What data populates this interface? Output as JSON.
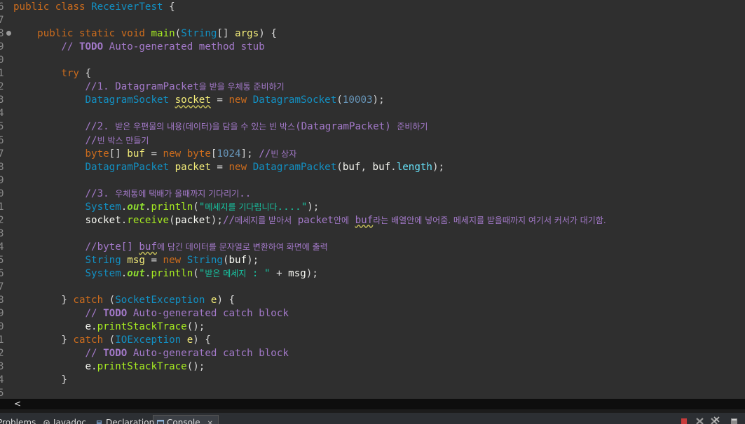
{
  "editor": {
    "lines": [
      {
        "n": "6",
        "html": "<span class=\"kw\">public</span> <span class=\"kw\">class</span> <span class=\"cls\">ReceiverTest</span> {"
      },
      {
        "n": "7",
        "html": ""
      },
      {
        "n": "8",
        "html": "    <span class=\"kw\">public</span> <span class=\"kw\">static</span> <span class=\"kw\">void</span> <span class=\"mth\">main</span>(<span class=\"cls\">String</span>[] <span class=\"var\">args</span>) {"
      },
      {
        "n": "9",
        "html": "        <span class=\"cmt\">// <span class=\"cmt-todo\">TODO</span> Auto-generated method stub</span>"
      },
      {
        "n": "0",
        "html": ""
      },
      {
        "n": "1",
        "html": "        <span class=\"kw\">try</span> {"
      },
      {
        "n": "2",
        "html": "            <span class=\"cmt\">//1. DatagramPacket<span class=\"kr\">을 받을 우체통 준비하기</span></span>"
      },
      {
        "n": "3",
        "html": "            <span class=\"cls\">DatagramSocket</span> <span class=\"var warn\">socket</span> = <span class=\"kw\">new</span> <span class=\"cls\">DatagramSocket</span>(<span class=\"num\">10003</span>);"
      },
      {
        "n": "4",
        "html": ""
      },
      {
        "n": "5",
        "html": "            <span class=\"cmt\">//2. <span class=\"kr\">받은 우편물의 내용(데이터)을 담을 수 있는 빈 박스</span>(DatagramPacket) <span class=\"kr\">준비하기</span></span>"
      },
      {
        "n": "6",
        "html": "            <span class=\"cmt\">//<span class=\"kr\">빈 박스 만들기</span></span>"
      },
      {
        "n": "7",
        "html": "            <span class=\"kw\">byte</span>[] <span class=\"var\">buf</span> = <span class=\"kw\">new</span> <span class=\"kw\">byte</span>[<span class=\"num\">1024</span>]; <span class=\"cmt\">//<span class=\"kr\">빈 상자</span></span>"
      },
      {
        "n": "8",
        "html": "            <span class=\"cls\">DatagramPacket</span> <span class=\"var\">packet</span> = <span class=\"kw\">new</span> <span class=\"cls\">DatagramPacket</span>(<span class=\"plain\">buf</span>, <span class=\"plain\">buf</span>.<span class=\"fld\">length</span>);"
      },
      {
        "n": "9",
        "html": ""
      },
      {
        "n": "0",
        "html": "            <span class=\"cmt\">//3. <span class=\"kr\">우체통에 택배가 올때까지 기다리기</span>..</span>"
      },
      {
        "n": "1",
        "html": "            <span class=\"cls\">System</span>.<span class=\"static-fld\">out</span>.<span class=\"mth\">println</span>(<span class=\"str\">\"<span class=\"kr\">메세지를 기다립니다</span>....\"</span>);"
      },
      {
        "n": "2",
        "html": "            <span class=\"plain\">socket</span>.<span class=\"mth\">receive</span>(<span class=\"plain\">packet</span>);<span class=\"cmt\">//<span class=\"kr\">메세지를 받아서</span> packet<span class=\"kr\">안에</span> <span class=\"warn\">buf</span><span class=\"kr\">라는 배열안에 넣어줌. 메세지를 받을때까지 여기서 커서가 대기함.</span></span>"
      },
      {
        "n": "3",
        "html": ""
      },
      {
        "n": "4",
        "html": "            <span class=\"cmt\">//byte[] <span class=\"warn\">buf</span><span class=\"kr\">에 담긴 데이터를 문자열로 변환하여 화면에 출력</span></span>"
      },
      {
        "n": "5",
        "html": "            <span class=\"cls\">String</span> <span class=\"var\">msg</span> = <span class=\"kw\">new</span> <span class=\"cls\">String</span>(<span class=\"plain\">buf</span>);"
      },
      {
        "n": "6",
        "html": "            <span class=\"cls\">System</span>.<span class=\"static-fld\">out</span>.<span class=\"mth\">println</span>(<span class=\"str\">\"<span class=\"kr\">받은 메세지</span> : \"</span> + <span class=\"plain\">msg</span>);"
      },
      {
        "n": "7",
        "html": ""
      },
      {
        "n": "8",
        "html": "        } <span class=\"kw\">catch</span> (<span class=\"cls\">SocketException</span> <span class=\"var\">e</span>) {"
      },
      {
        "n": "9",
        "html": "            <span class=\"cmt\">// <span class=\"cmt-todo\">TODO</span> Auto-generated catch block</span>"
      },
      {
        "n": "0",
        "html": "            <span class=\"plain\">e</span>.<span class=\"mth\">printStackTrace</span>();"
      },
      {
        "n": "1",
        "html": "        } <span class=\"kw\">catch</span> (<span class=\"cls\">IOException</span> <span class=\"var\">e</span>) {"
      },
      {
        "n": "2",
        "html": "            <span class=\"cmt\">// <span class=\"cmt-todo\">TODO</span> Auto-generated catch block</span>"
      },
      {
        "n": "3",
        "html": "            <span class=\"plain\">e</span>.<span class=\"mth\">printStackTrace</span>();"
      },
      {
        "n": "4",
        "html": "        }"
      },
      {
        "n": "5",
        "html": ""
      }
    ]
  },
  "scrollbar": {
    "left_arrow": "<"
  },
  "bottom_panel": {
    "tabs": [
      {
        "label": "Problems",
        "icon": "problems-icon"
      },
      {
        "label": "Javadoc",
        "icon": "at-icon"
      },
      {
        "label": "Declaration",
        "icon": "declaration-icon"
      },
      {
        "label": "Console",
        "icon": "console-icon"
      }
    ],
    "close_glyph": "✕",
    "toolbar": [
      "terminate-icon",
      "remove-launch-icon",
      "remove-all-icon",
      "clear-console-icon"
    ]
  },
  "colors": {
    "background": "#2f2f2f",
    "keyword": "#cc6c1d",
    "class": "#1290c3",
    "method": "#a7ec21",
    "comment": "#a379c9",
    "string": "#17c6a3",
    "number": "#6897bb",
    "variable": "#f3ec79"
  }
}
